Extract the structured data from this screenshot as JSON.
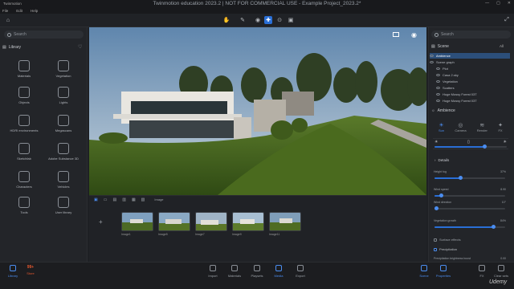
{
  "window": {
    "app_name": "Twinmotion",
    "title": "Twinmotion education 2023.2 | NOT FOR COMMERCIAL USE - Example Project_2023.2*",
    "menu": [
      "File",
      "Edit",
      "Help"
    ]
  },
  "library": {
    "search_placeholder": "Search",
    "heading": "Library",
    "items": [
      {
        "label": "Materials",
        "icon": "materials-icon"
      },
      {
        "label": "Vegetation",
        "icon": "vegetation-icon"
      },
      {
        "label": "Objects",
        "icon": "objects-icon"
      },
      {
        "label": "Lights",
        "icon": "lights-icon"
      },
      {
        "label": "HDRI environments",
        "icon": "hdri-icon"
      },
      {
        "label": "Megascans",
        "icon": "megascans-icon"
      },
      {
        "label": "Sketchfab",
        "icon": "sketchfab-icon"
      },
      {
        "label": "Adobe Substance 3D",
        "icon": "substance-icon"
      },
      {
        "label": "Characters",
        "icon": "characters-icon"
      },
      {
        "label": "Vehicles",
        "icon": "vehicles-icon"
      },
      {
        "label": "Tools",
        "icon": "tools-icon"
      },
      {
        "label": "User library",
        "icon": "user-library-icon"
      }
    ]
  },
  "strip": {
    "tab_label": "Image",
    "thumbs": [
      "Image1",
      "Image5",
      "Image7",
      "Image9",
      "Image11"
    ]
  },
  "scene": {
    "search_placeholder": "Search",
    "heading": "Scene",
    "filter": "All",
    "rows": [
      "Ambience",
      "Scene graph",
      "Plot",
      "Casa 2.sky",
      "Vegetation",
      "Scatters",
      "Huge Mossy Forest 03T",
      "Huge Mossy Forest 03T"
    ]
  },
  "ambience": {
    "heading": "Ambience",
    "tabs": [
      "Sun",
      "Camera",
      "Render",
      "FX"
    ],
    "details_label": "Details",
    "props": [
      {
        "label": "Height fog",
        "value": "37%",
        "level": 0.37
      },
      {
        "label": "Wind speed",
        "value": "8.90",
        "level": 0.1
      },
      {
        "label": "Wind direction",
        "value": "10°",
        "level": 0.03
      },
      {
        "label": "Vegetation growth",
        "value": "84%",
        "level": 0.84
      }
    ],
    "surface_effects": "Surface effects",
    "precipitation": "Precipitation",
    "precip_brightness": "Precipitation brightness boost",
    "precip_brightness_value": "0.00"
  },
  "bottombar": {
    "library": "Library",
    "store": "Store",
    "store_badge": "99+",
    "import": "Import",
    "materials": "Materials",
    "playsets": "Playsets",
    "media": "Media",
    "export": "Export",
    "scene": "Scene",
    "properties": "Properties",
    "fx": "FX",
    "clear_sets": "Clear sets"
  },
  "watermark": "Udemy"
}
